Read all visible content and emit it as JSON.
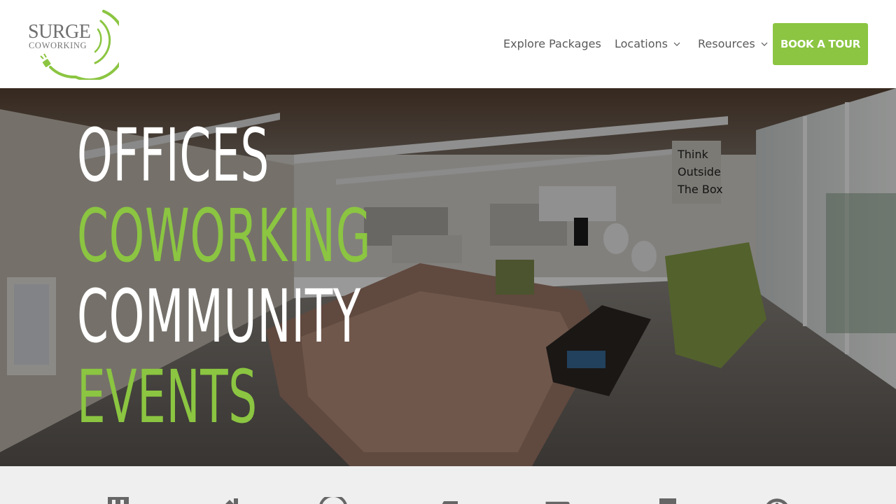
{
  "brand": {
    "name_line1": "SURGE",
    "name_line2": "COWORKING",
    "logo_color": "#8bc541",
    "text_color": "#6f6f6f"
  },
  "nav": {
    "items": [
      {
        "label": "Explore Packages",
        "dropdown": false
      },
      {
        "label": "Locations",
        "dropdown": true
      },
      {
        "label": "Resources",
        "dropdown": true
      }
    ],
    "cta_label": "BOOK A TOUR",
    "cta_color": "#8bc541"
  },
  "hero": {
    "lines": [
      {
        "text": "OFFICES",
        "color": "#ffffff"
      },
      {
        "text": "COWORKING",
        "color": "#8bc541"
      },
      {
        "text": "COMMUNITY",
        "color": "#ffffff"
      },
      {
        "text": "EVENTS",
        "color": "#8bc541"
      }
    ],
    "background_description_icons": [
      "building-icon",
      "house-icon",
      "globe-icon",
      "tag-icon",
      "ticket-icon",
      "door-icon",
      "clock-icon"
    ]
  }
}
